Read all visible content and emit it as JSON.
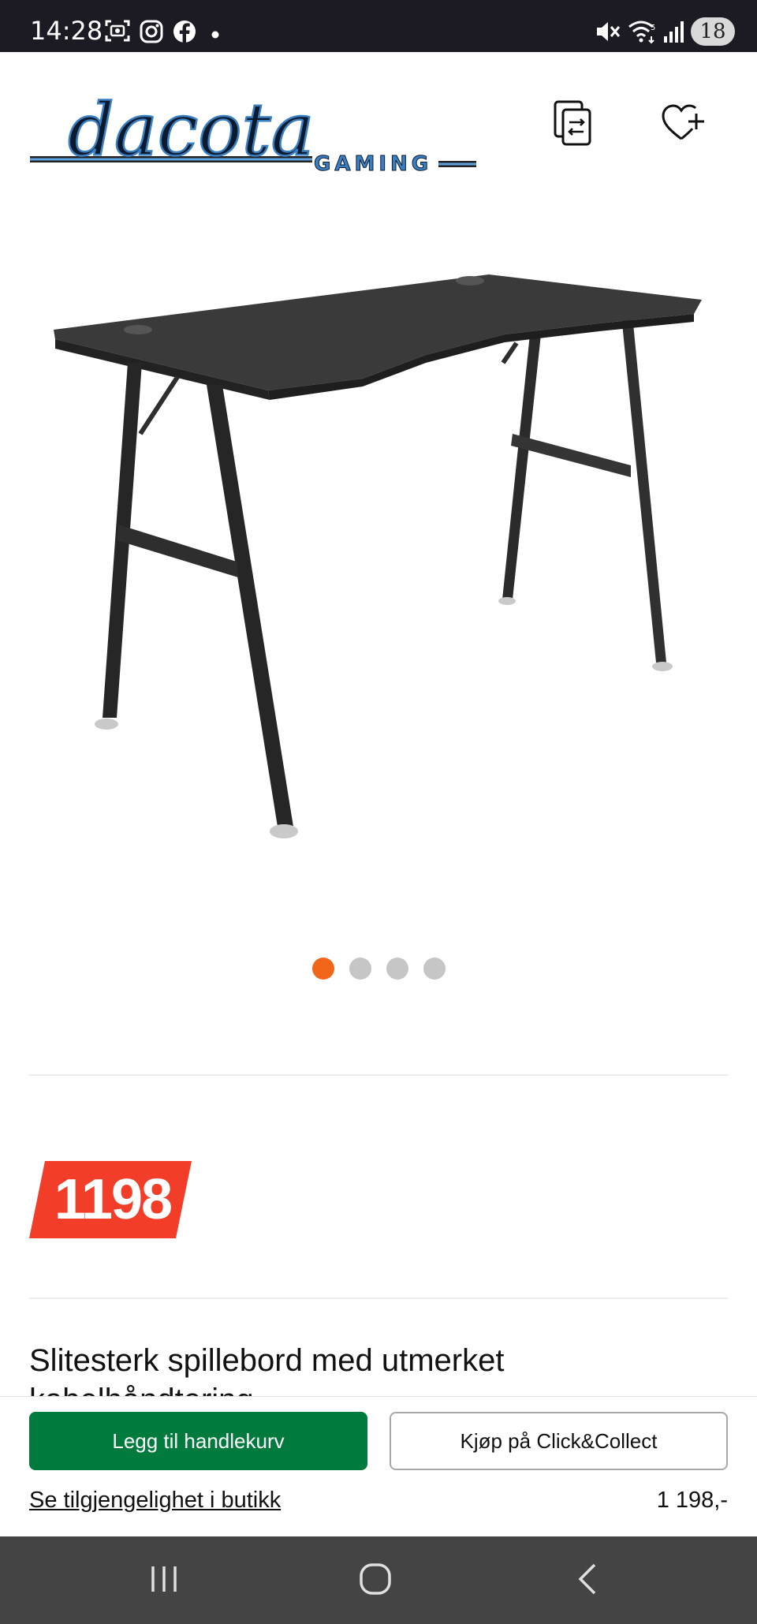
{
  "status_bar": {
    "time": "14:28",
    "battery": "18",
    "icons": [
      "screenshot-icon",
      "instagram-icon",
      "facebook-icon",
      "dot-icon",
      "mute-icon",
      "wifi-icon",
      "signal-icon"
    ]
  },
  "header": {
    "logo_text": "dacota",
    "logo_sub": "GAMING",
    "compare_icon": "compare-icon",
    "wishlist_icon": "heart-plus-icon"
  },
  "gallery": {
    "image_name": "gaming desk",
    "total_slides": 4,
    "active_index": 0
  },
  "price": {
    "badge": "1198",
    "badge_color": "#f23d28"
  },
  "product": {
    "title": "Slitesterk spillebord med utmerket kabelhåndtering"
  },
  "actions": {
    "add_to_cart": "Legg til handlekurv",
    "click_collect": "Kjøp på Click&Collect",
    "availability_link": "Se tilgjengelighet i butikk",
    "price": "1 198,-"
  },
  "colors": {
    "primary_green": "#007a3d",
    "accent_orange": "#f2661a",
    "logo_blue": "#3a7fc1"
  },
  "nav": {
    "recents": "recents-icon",
    "home": "home-icon",
    "back": "back-icon"
  }
}
